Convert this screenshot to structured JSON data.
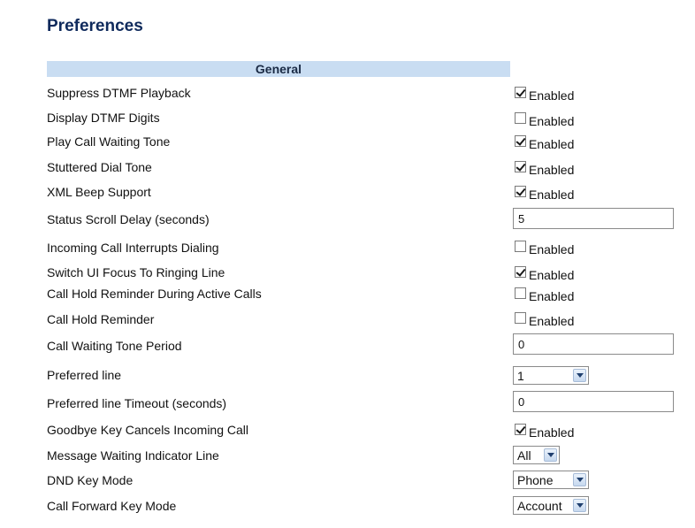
{
  "page": {
    "title": "Preferences"
  },
  "section": {
    "header": "General"
  },
  "fields": {
    "suppress_dtmf": {
      "label": "Suppress DTMF Playback",
      "option": "Enabled",
      "checked": true
    },
    "display_dtmf": {
      "label": "Display DTMF Digits",
      "option": "Enabled",
      "checked": false
    },
    "play_call_waiting_tone": {
      "label": "Play Call Waiting Tone",
      "option": "Enabled",
      "checked": true
    },
    "stuttered_dial_tone": {
      "label": "Stuttered Dial Tone",
      "option": "Enabled",
      "checked": true
    },
    "xml_beep_support": {
      "label": "XML Beep Support",
      "option": "Enabled",
      "checked": true
    },
    "status_scroll_delay": {
      "label": "Status Scroll Delay (seconds)",
      "value": "5"
    },
    "incoming_call_interrupts": {
      "label": "Incoming Call Interrupts Dialing",
      "option": "Enabled",
      "checked": false
    },
    "switch_ui_focus": {
      "label": "Switch UI Focus To Ringing Line",
      "option": "Enabled",
      "checked": true
    },
    "call_hold_reminder_active": {
      "label": "Call Hold Reminder During Active Calls",
      "option": "Enabled",
      "checked": false
    },
    "call_hold_reminder": {
      "label": "Call Hold Reminder",
      "option": "Enabled",
      "checked": false
    },
    "call_waiting_tone_period": {
      "label": "Call Waiting Tone Period",
      "value": "0"
    },
    "preferred_line": {
      "label": "Preferred line",
      "selected": "1"
    },
    "preferred_line_timeout": {
      "label": "Preferred line Timeout (seconds)",
      "value": "0"
    },
    "goodbye_key_cancels": {
      "label": "Goodbye Key Cancels Incoming Call",
      "option": "Enabled",
      "checked": true
    },
    "mwi_line": {
      "label": "Message Waiting Indicator Line",
      "selected": "All"
    },
    "dnd_key_mode": {
      "label": "DND Key Mode",
      "selected": "Phone"
    },
    "call_forward_key_mode": {
      "label": "Call Forward Key Mode",
      "selected": "Account"
    }
  }
}
